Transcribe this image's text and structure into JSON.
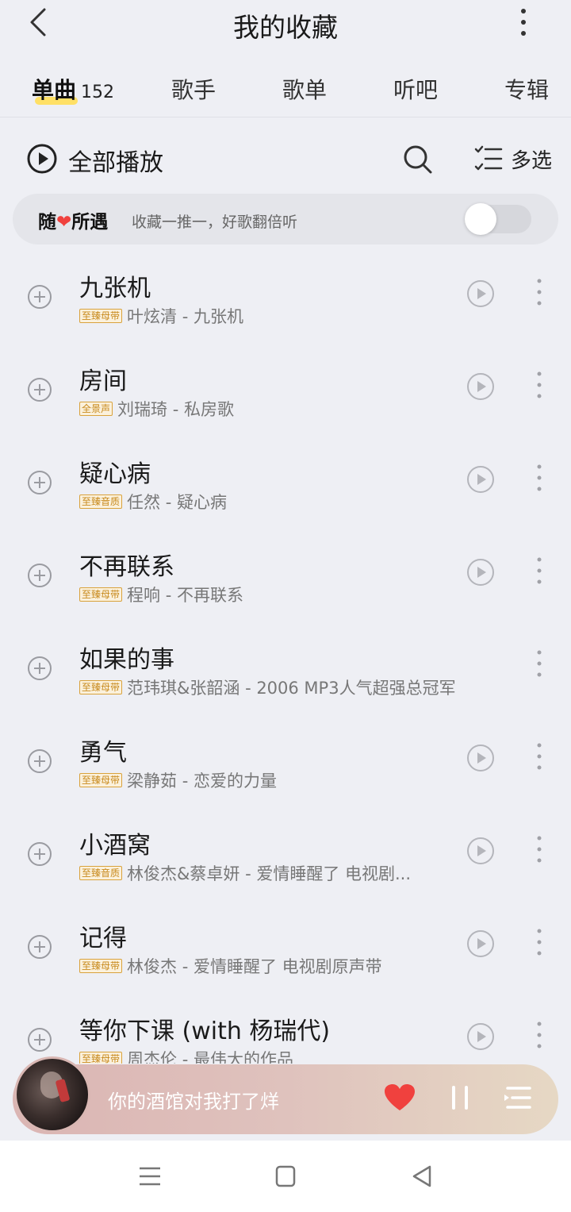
{
  "header": {
    "title": "我的收藏",
    "back_icon": "chevron-left-icon",
    "more_icon": "more-vertical-icon"
  },
  "tabs": [
    {
      "label": "单曲",
      "count": "152",
      "active": true
    },
    {
      "label": "歌手"
    },
    {
      "label": "歌单"
    },
    {
      "label": "听吧"
    },
    {
      "label": "专辑"
    }
  ],
  "toolbar": {
    "play_all": "全部播放",
    "multi_select": "多选"
  },
  "shuffle_bar": {
    "title_pre": "随",
    "title_post": "所遇",
    "subtitle": "收藏一推一，好歌翻倍听",
    "enabled": false
  },
  "songs": [
    {
      "title": "九张机",
      "badge": "至臻母带",
      "artist": "叶炫清 - 九张机",
      "playable": true
    },
    {
      "title": "房间",
      "badge": "全景声",
      "artist": "刘瑞琦 - 私房歌",
      "playable": true
    },
    {
      "title": "疑心病",
      "badge": "至臻音质",
      "artist": "任然 - 疑心病",
      "playable": true
    },
    {
      "title": "不再联系",
      "badge": "至臻母带",
      "artist": "程响 - 不再联系",
      "playable": true
    },
    {
      "title": "如果的事",
      "badge": "至臻母带",
      "artist": "范玮琪&张韶涵 - 2006 MP3人气超强总冠军",
      "playable": false
    },
    {
      "title": "勇气",
      "badge": "至臻母带",
      "artist": "梁静茹 - 恋爱的力量",
      "playable": true
    },
    {
      "title": "小酒窝",
      "badge": "至臻音质",
      "artist": "林俊杰&蔡卓妍 - 爱情睡醒了 电视剧...",
      "playable": true
    },
    {
      "title": "记得",
      "badge": "至臻母带",
      "artist": "林俊杰 - 爱情睡醒了 电视剧原声带",
      "playable": true
    },
    {
      "title": "等你下课 (with 杨瑞代)",
      "badge": "至臻母带",
      "artist": "周杰伦 - 最伟大的作品",
      "playable": true
    }
  ],
  "player": {
    "now_playing": "你的酒馆对我打了烊",
    "liked": true,
    "state": "playing",
    "accent_color": "#f0413e"
  },
  "colors": {
    "background": "#eeeff4",
    "badge_gold": "#c88a1e",
    "tab_highlight": "#ffe066"
  }
}
